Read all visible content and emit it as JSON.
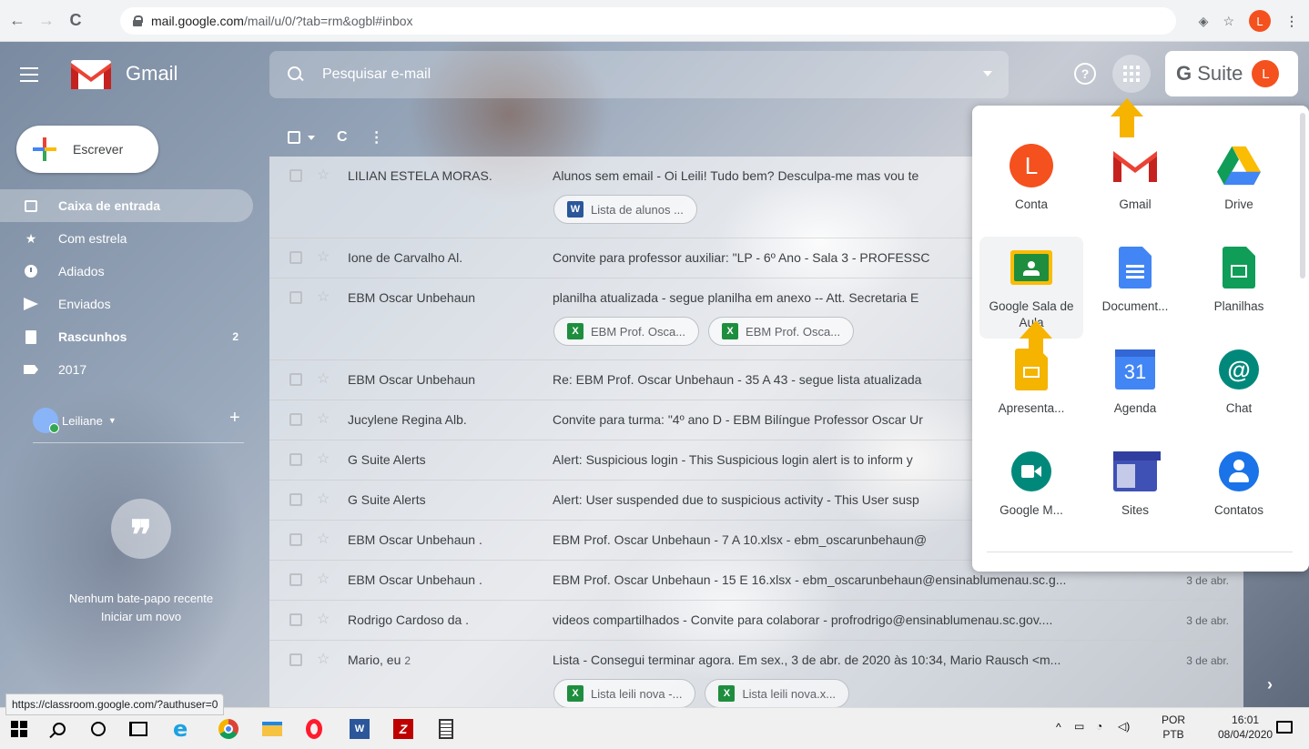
{
  "browser": {
    "url_host": "mail.google.com",
    "url_path": "/mail/u/0/?tab=rm&ogbl#inbox",
    "profile_initial": "L"
  },
  "header": {
    "app_name": "Gmail",
    "search_placeholder": "Pesquisar e-mail",
    "help_glyph": "?",
    "gsuite_g": "G",
    "gsuite_text": " Suite",
    "avatar_initial": "L"
  },
  "sidebar": {
    "compose_label": "Escrever",
    "items": [
      {
        "label": "Caixa de entrada",
        "icon": "inbox-icon",
        "count": ""
      },
      {
        "label": "Com estrela",
        "icon": "star-icon",
        "count": ""
      },
      {
        "label": "Adiados",
        "icon": "clock-icon",
        "count": ""
      },
      {
        "label": "Enviados",
        "icon": "send-icon",
        "count": ""
      },
      {
        "label": "Rascunhos",
        "icon": "draft-icon",
        "count": "2"
      },
      {
        "label": "2017",
        "icon": "label-icon",
        "count": ""
      }
    ],
    "hangouts_user": "Leiliane",
    "hangouts_plus": "+",
    "no_chat": "Nenhum bate-papo recente",
    "start_new": "Iniciar um novo",
    "status_url": "https://classroom.google.com/?authuser=0"
  },
  "mails": [
    {
      "sender": "LILIAN ESTELA MORAS.",
      "count": "",
      "snippet": "Alunos sem email - Oi Leili! Tudo bem? Desculpa-me mas vou te",
      "date": "",
      "chips": [
        {
          "type": "W",
          "label": "Lista de alunos ..."
        }
      ]
    },
    {
      "sender": "Ione de Carvalho Al.",
      "count": "",
      "snippet": "Convite para professor auxiliar: \"LP - 6º Ano - Sala 3 - PROFESSC",
      "date": "",
      "chips": []
    },
    {
      "sender": "EBM Oscar Unbehaun",
      "count": "",
      "snippet": "planilha atualizada - segue planilha em anexo -- Att. Secretaria E",
      "date": "",
      "chips": [
        {
          "type": "X",
          "label": "EBM Prof. Osca..."
        },
        {
          "type": "X",
          "label": "EBM Prof. Osca..."
        }
      ]
    },
    {
      "sender": "EBM Oscar Unbehaun",
      "count": "",
      "snippet": "Re: EBM Prof. Oscar Unbehaun - 35 A 43 - segue lista atualizada",
      "date": "",
      "chips": []
    },
    {
      "sender": "Jucylene Regina Alb.",
      "count": "",
      "snippet": "Convite para turma: \"4º ano D - EBM Bilíngue Professor Oscar Ur",
      "date": "",
      "chips": []
    },
    {
      "sender": "G Suite Alerts",
      "count": "",
      "snippet": "Alert: Suspicious login - This Suspicious login alert is to inform y",
      "date": "",
      "chips": []
    },
    {
      "sender": "G Suite Alerts",
      "count": "",
      "snippet": "Alert: User suspended due to suspicious activity - This User susp",
      "date": "",
      "chips": []
    },
    {
      "sender": "EBM Oscar Unbehaun .",
      "count": "",
      "snippet": "EBM Prof. Oscar Unbehaun - 7 A 10.xlsx - ebm_oscarunbehaun@",
      "date": "",
      "chips": []
    },
    {
      "sender": "EBM Oscar Unbehaun .",
      "count": "",
      "snippet": "EBM Prof. Oscar Unbehaun - 15 E 16.xlsx - ebm_oscarunbehaun@ensinablumenau.sc.g...",
      "date": "3 de abr.",
      "chips": []
    },
    {
      "sender": "Rodrigo Cardoso da .",
      "count": "",
      "snippet": "videos compartilhados - Convite para colaborar - profrodrigo@ensinablumenau.sc.gov....",
      "date": "3 de abr.",
      "chips": []
    },
    {
      "sender": "Mario, eu",
      "count": "2",
      "snippet": "Lista - Consegui terminar agora. Em sex., 3 de abr. de 2020 às 10:34, Mario Rausch <m...",
      "date": "3 de abr.",
      "chips": [
        {
          "type": "X",
          "label": "Lista leili nova -..."
        },
        {
          "type": "X",
          "label": "Lista leili nova.x..."
        }
      ]
    }
  ],
  "launcher": {
    "apps": [
      {
        "label": "Conta",
        "icon": "account-icon",
        "glyph": "L"
      },
      {
        "label": "Gmail",
        "icon": "gmail-icon",
        "glyph": ""
      },
      {
        "label": "Drive",
        "icon": "drive-icon",
        "glyph": ""
      },
      {
        "label": "Google Sala de Aula",
        "icon": "classroom-icon",
        "glyph": ""
      },
      {
        "label": "Document...",
        "icon": "docs-icon",
        "glyph": ""
      },
      {
        "label": "Planilhas",
        "icon": "sheets-icon",
        "glyph": ""
      },
      {
        "label": "Apresenta...",
        "icon": "slides-icon",
        "glyph": ""
      },
      {
        "label": "Agenda",
        "icon": "calendar-icon",
        "glyph": "31"
      },
      {
        "label": "Chat",
        "icon": "chat-icon",
        "glyph": "@"
      },
      {
        "label": "Google M...",
        "icon": "meet-icon",
        "glyph": ""
      },
      {
        "label": "Sites",
        "icon": "sites-icon",
        "glyph": ""
      },
      {
        "label": "Contatos",
        "icon": "contacts-icon",
        "glyph": ""
      }
    ]
  },
  "taskbar": {
    "lang_top": "POR",
    "lang_bottom": "PTB",
    "time": "16:01",
    "date": "08/04/2020"
  },
  "colors": {
    "accent_red": "#ea4335",
    "accent_blue": "#4285f4",
    "accent_yellow": "#fbbc05",
    "accent_green": "#34a853",
    "arrow": "#f6b400"
  }
}
